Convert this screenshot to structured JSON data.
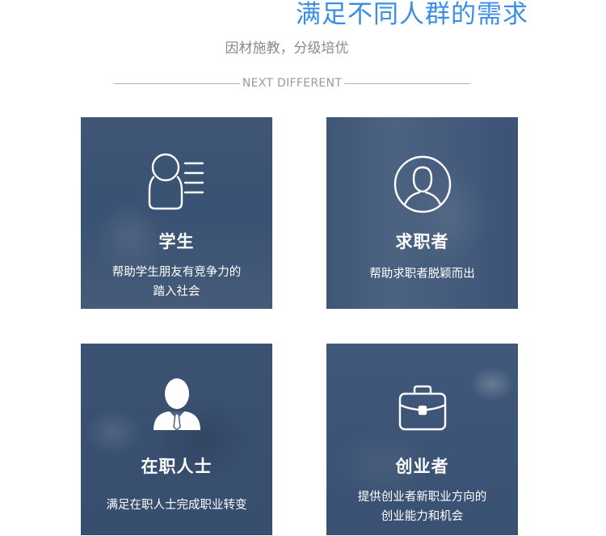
{
  "header": {
    "title": "满足不同人群的需求",
    "subtitle": "因材施教，分级培优",
    "divider_text": "NEXT DIFFERENT"
  },
  "cards": [
    {
      "icon": "student-profile-icon",
      "name": "学生",
      "desc_line1": "帮助学生朋友有竞争力的",
      "desc_line2": "踏入社会"
    },
    {
      "icon": "job-seeker-icon",
      "name": "求职者",
      "desc_line1": "帮助求职者脱颖而出",
      "desc_line2": ""
    },
    {
      "icon": "businessman-icon",
      "name": "在职人士",
      "desc_line1": "满足在职人士完成职业转变",
      "desc_line2": ""
    },
    {
      "icon": "briefcase-icon",
      "name": "创业者",
      "desc_line1": "提供创业者新职业方向的",
      "desc_line2": "创业能力和机会"
    }
  ],
  "colors": {
    "title": "#3a8ee6",
    "subtitle": "#8a8a8a",
    "card_overlay": "#284268"
  }
}
